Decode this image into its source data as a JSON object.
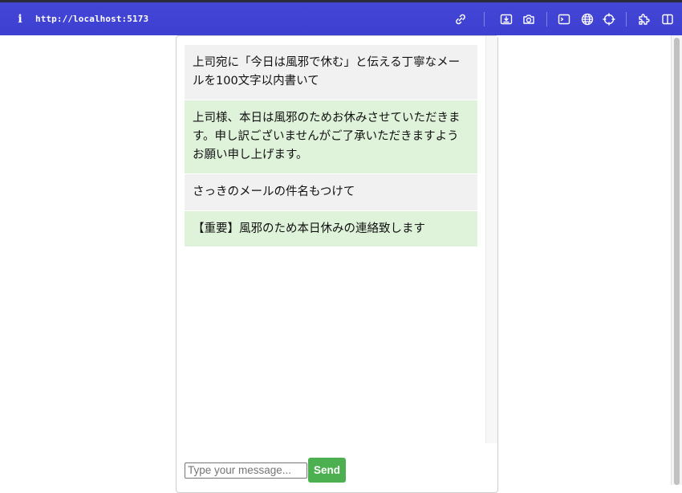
{
  "browser": {
    "url": "http://localhost:5173",
    "info_glyph": "i",
    "toolbar_icons": [
      "link-icon",
      "screencast-icon",
      "camera-icon",
      "terminal-icon",
      "globe-icon",
      "crosshair-icon",
      "extension-icon",
      "split-view-icon"
    ],
    "toolbar_color": "#4446d6"
  },
  "chat": {
    "messages": [
      {
        "role": "user",
        "text": "上司宛に「今日は風邪で休む」と伝える丁寧なメールを100文字以内書いて"
      },
      {
        "role": "assistant",
        "text": "上司様、本日は風邪のためお休みさせていただきます。申し訳ございませんがご了承いただきますようお願い申し上げます。"
      },
      {
        "role": "user",
        "text": "さっきのメールの件名もつけて"
      },
      {
        "role": "assistant",
        "text": "【重要】風邪のため本日休みの連絡致します"
      }
    ],
    "input": {
      "value": "",
      "placeholder": "Type your message..."
    },
    "send_label": "Send",
    "colors": {
      "user_bg": "#f1f1f1",
      "assistant_bg": "#dff2da",
      "send_bg": "#4caf50"
    }
  }
}
